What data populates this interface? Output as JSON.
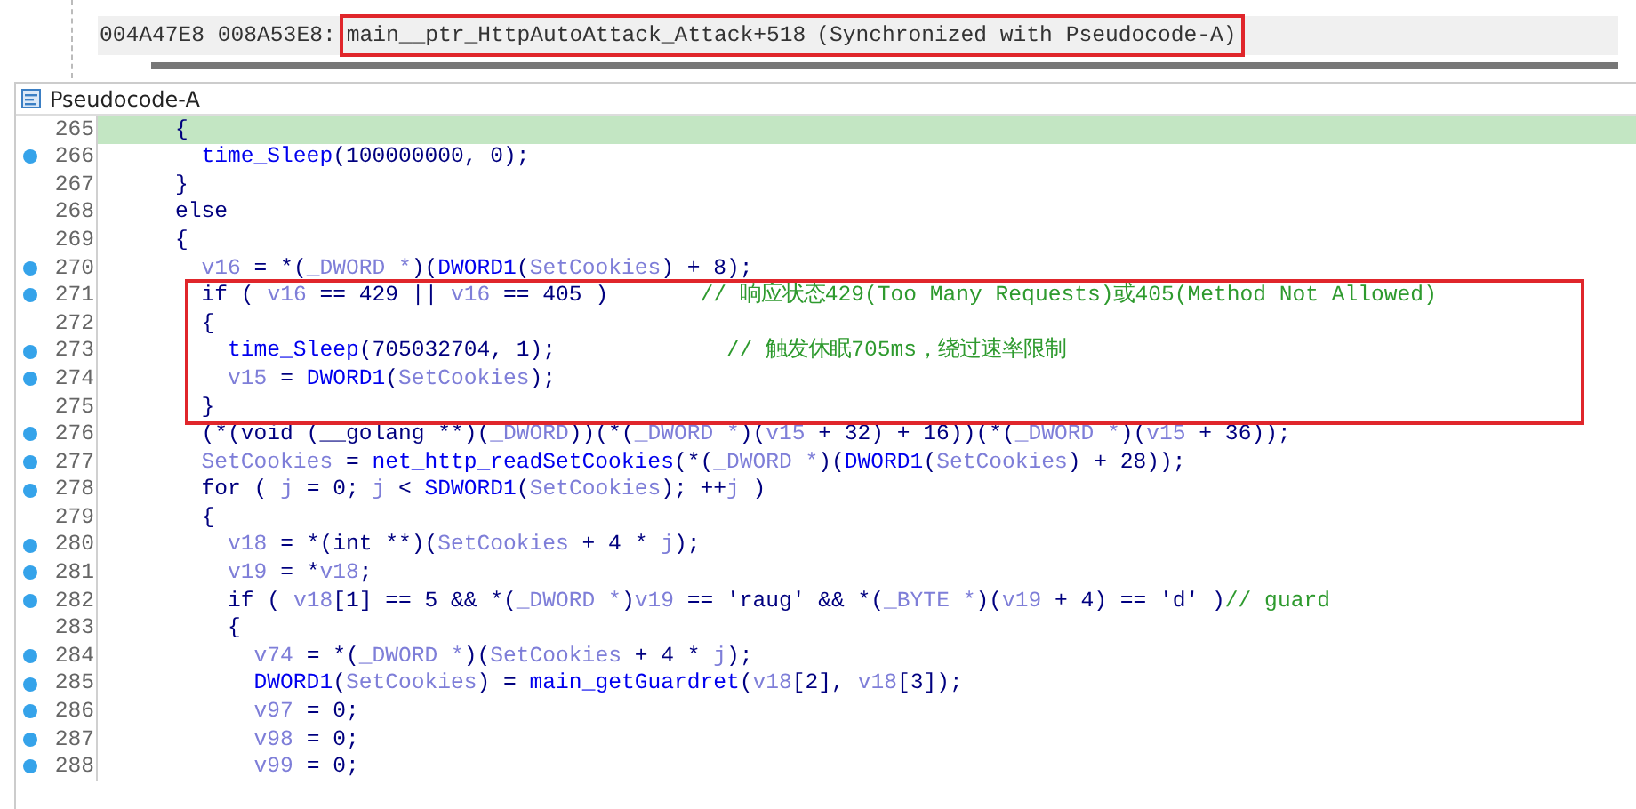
{
  "address_bar": {
    "address": "004A47E8 008A53E8:",
    "location": "main__ptr_HttpAutoAttack_Attack+518",
    "sync": "(Synchronized with Pseudocode-A)",
    "boxed": true
  },
  "tab": {
    "title": "Pseudocode-A"
  },
  "lines": [
    {
      "number": "265",
      "breakpoint": false,
      "highlighted": true,
      "boxed": false,
      "tokens": [
        {
          "kind": "plain",
          "text": "    {"
        }
      ]
    },
    {
      "number": "266",
      "breakpoint": true,
      "highlighted": false,
      "boxed": false,
      "tokens": [
        {
          "kind": "fn",
          "text": "      time_Sleep"
        },
        {
          "kind": "plain",
          "text": "(100000000, 0);"
        }
      ]
    },
    {
      "number": "267",
      "breakpoint": false,
      "highlighted": false,
      "boxed": false,
      "tokens": [
        {
          "kind": "plain",
          "text": "    }"
        }
      ]
    },
    {
      "number": "268",
      "breakpoint": false,
      "highlighted": false,
      "boxed": false,
      "tokens": [
        {
          "kind": "plain",
          "text": "    else"
        }
      ]
    },
    {
      "number": "269",
      "breakpoint": false,
      "highlighted": false,
      "boxed": false,
      "tokens": [
        {
          "kind": "plain",
          "text": "    {"
        }
      ]
    },
    {
      "number": "270",
      "breakpoint": true,
      "highlighted": false,
      "boxed": false,
      "tokens": [
        {
          "kind": "light",
          "text": "      v16"
        },
        {
          "kind": "plain",
          "text": " = *("
        },
        {
          "kind": "light",
          "text": "_DWORD *"
        },
        {
          "kind": "plain",
          "text": ")("
        },
        {
          "kind": "fn",
          "text": "DWORD1"
        },
        {
          "kind": "plain",
          "text": "("
        },
        {
          "kind": "light",
          "text": "SetCookies"
        },
        {
          "kind": "plain",
          "text": ") + 8);"
        }
      ]
    },
    {
      "number": "271",
      "breakpoint": true,
      "highlighted": false,
      "boxed": true,
      "tokens": [
        {
          "kind": "plain",
          "text": "      if ( "
        },
        {
          "kind": "light",
          "text": "v16"
        },
        {
          "kind": "plain",
          "text": " == 429 || "
        },
        {
          "kind": "light",
          "text": "v16"
        },
        {
          "kind": "plain",
          "text": " == 405 )       "
        },
        {
          "kind": "comment",
          "text": "// 响应状态429(Too Many Requests)或405(Method Not Allowed)"
        }
      ]
    },
    {
      "number": "272",
      "breakpoint": false,
      "highlighted": false,
      "boxed": true,
      "tokens": [
        {
          "kind": "plain",
          "text": "      {"
        }
      ]
    },
    {
      "number": "273",
      "breakpoint": true,
      "highlighted": false,
      "boxed": true,
      "tokens": [
        {
          "kind": "fn",
          "text": "        time_Sleep"
        },
        {
          "kind": "plain",
          "text": "(705032704, 1);             "
        },
        {
          "kind": "comment",
          "text": "// 触发休眠705ms，绕过速率限制"
        }
      ]
    },
    {
      "number": "274",
      "breakpoint": true,
      "highlighted": false,
      "boxed": true,
      "tokens": [
        {
          "kind": "light",
          "text": "        v15"
        },
        {
          "kind": "plain",
          "text": " = "
        },
        {
          "kind": "fn",
          "text": "DWORD1"
        },
        {
          "kind": "plain",
          "text": "("
        },
        {
          "kind": "light",
          "text": "SetCookies"
        },
        {
          "kind": "plain",
          "text": ");"
        }
      ]
    },
    {
      "number": "275",
      "breakpoint": false,
      "highlighted": false,
      "boxed": true,
      "tokens": [
        {
          "kind": "plain",
          "text": "      }"
        }
      ]
    },
    {
      "number": "276",
      "breakpoint": true,
      "highlighted": false,
      "boxed": false,
      "tokens": [
        {
          "kind": "plain",
          "text": "      (*(void (__golang **)("
        },
        {
          "kind": "light",
          "text": "_DWORD"
        },
        {
          "kind": "plain",
          "text": "))(*("
        },
        {
          "kind": "light",
          "text": "_DWORD *"
        },
        {
          "kind": "plain",
          "text": ")("
        },
        {
          "kind": "light",
          "text": "v15"
        },
        {
          "kind": "plain",
          "text": " + 32) + 16))(*("
        },
        {
          "kind": "light",
          "text": "_DWORD *"
        },
        {
          "kind": "plain",
          "text": ")("
        },
        {
          "kind": "light",
          "text": "v15"
        },
        {
          "kind": "plain",
          "text": " + 36));"
        }
      ]
    },
    {
      "number": "277",
      "breakpoint": true,
      "highlighted": false,
      "boxed": false,
      "tokens": [
        {
          "kind": "light",
          "text": "      SetCookies"
        },
        {
          "kind": "plain",
          "text": " = "
        },
        {
          "kind": "fn",
          "text": "net_http_readSetCookies"
        },
        {
          "kind": "plain",
          "text": "(*("
        },
        {
          "kind": "light",
          "text": "_DWORD *"
        },
        {
          "kind": "plain",
          "text": ")("
        },
        {
          "kind": "fn",
          "text": "DWORD1"
        },
        {
          "kind": "plain",
          "text": "("
        },
        {
          "kind": "light",
          "text": "SetCookies"
        },
        {
          "kind": "plain",
          "text": ") + 28));"
        }
      ]
    },
    {
      "number": "278",
      "breakpoint": true,
      "highlighted": false,
      "boxed": false,
      "tokens": [
        {
          "kind": "plain",
          "text": "      for ( "
        },
        {
          "kind": "light",
          "text": "j"
        },
        {
          "kind": "plain",
          "text": " = 0; "
        },
        {
          "kind": "light",
          "text": "j"
        },
        {
          "kind": "plain",
          "text": " < "
        },
        {
          "kind": "fn",
          "text": "SDWORD1"
        },
        {
          "kind": "plain",
          "text": "("
        },
        {
          "kind": "light",
          "text": "SetCookies"
        },
        {
          "kind": "plain",
          "text": "); ++"
        },
        {
          "kind": "light",
          "text": "j"
        },
        {
          "kind": "plain",
          "text": " )"
        }
      ]
    },
    {
      "number": "279",
      "breakpoint": false,
      "highlighted": false,
      "boxed": false,
      "tokens": [
        {
          "kind": "plain",
          "text": "      {"
        }
      ]
    },
    {
      "number": "280",
      "breakpoint": true,
      "highlighted": false,
      "boxed": false,
      "tokens": [
        {
          "kind": "light",
          "text": "        v18"
        },
        {
          "kind": "plain",
          "text": " = *(int **)("
        },
        {
          "kind": "light",
          "text": "SetCookies"
        },
        {
          "kind": "plain",
          "text": " + 4 * "
        },
        {
          "kind": "light",
          "text": "j"
        },
        {
          "kind": "plain",
          "text": ");"
        }
      ]
    },
    {
      "number": "281",
      "breakpoint": true,
      "highlighted": false,
      "boxed": false,
      "tokens": [
        {
          "kind": "light",
          "text": "        v19"
        },
        {
          "kind": "plain",
          "text": " = *"
        },
        {
          "kind": "light",
          "text": "v18"
        },
        {
          "kind": "plain",
          "text": ";"
        }
      ]
    },
    {
      "number": "282",
      "breakpoint": true,
      "highlighted": false,
      "boxed": false,
      "tokens": [
        {
          "kind": "plain",
          "text": "        if ( "
        },
        {
          "kind": "light",
          "text": "v18"
        },
        {
          "kind": "plain",
          "text": "[1] == 5 && *("
        },
        {
          "kind": "light",
          "text": "_DWORD *"
        },
        {
          "kind": "plain",
          "text": ")"
        },
        {
          "kind": "light",
          "text": "v19"
        },
        {
          "kind": "plain",
          "text": " == 'raug' && *("
        },
        {
          "kind": "light",
          "text": "_BYTE *"
        },
        {
          "kind": "plain",
          "text": ")("
        },
        {
          "kind": "light",
          "text": "v19"
        },
        {
          "kind": "plain",
          "text": " + 4) == 'd' )"
        },
        {
          "kind": "comment",
          "text": "// guard"
        }
      ]
    },
    {
      "number": "283",
      "breakpoint": false,
      "highlighted": false,
      "boxed": false,
      "tokens": [
        {
          "kind": "plain",
          "text": "        {"
        }
      ]
    },
    {
      "number": "284",
      "breakpoint": true,
      "highlighted": false,
      "boxed": false,
      "tokens": [
        {
          "kind": "light",
          "text": "          v74"
        },
        {
          "kind": "plain",
          "text": " = *("
        },
        {
          "kind": "light",
          "text": "_DWORD *"
        },
        {
          "kind": "plain",
          "text": ")("
        },
        {
          "kind": "light",
          "text": "SetCookies"
        },
        {
          "kind": "plain",
          "text": " + 4 * "
        },
        {
          "kind": "light",
          "text": "j"
        },
        {
          "kind": "plain",
          "text": ");"
        }
      ]
    },
    {
      "number": "285",
      "breakpoint": true,
      "highlighted": false,
      "boxed": false,
      "tokens": [
        {
          "kind": "fn",
          "text": "          DWORD1"
        },
        {
          "kind": "plain",
          "text": "("
        },
        {
          "kind": "light",
          "text": "SetCookies"
        },
        {
          "kind": "plain",
          "text": ") = "
        },
        {
          "kind": "fn",
          "text": "main_getGuardret"
        },
        {
          "kind": "plain",
          "text": "("
        },
        {
          "kind": "light",
          "text": "v18"
        },
        {
          "kind": "plain",
          "text": "[2], "
        },
        {
          "kind": "light",
          "text": "v18"
        },
        {
          "kind": "plain",
          "text": "[3]);"
        }
      ]
    },
    {
      "number": "286",
      "breakpoint": true,
      "highlighted": false,
      "boxed": false,
      "tokens": [
        {
          "kind": "light",
          "text": "          v97"
        },
        {
          "kind": "plain",
          "text": " = 0;"
        }
      ]
    },
    {
      "number": "287",
      "breakpoint": true,
      "highlighted": false,
      "boxed": false,
      "tokens": [
        {
          "kind": "light",
          "text": "          v98"
        },
        {
          "kind": "plain",
          "text": " = 0;"
        }
      ]
    },
    {
      "number": "288",
      "breakpoint": true,
      "highlighted": false,
      "boxed": false,
      "tokens": [
        {
          "kind": "light",
          "text": "          v99"
        },
        {
          "kind": "plain",
          "text": " = 0;"
        }
      ]
    }
  ]
}
